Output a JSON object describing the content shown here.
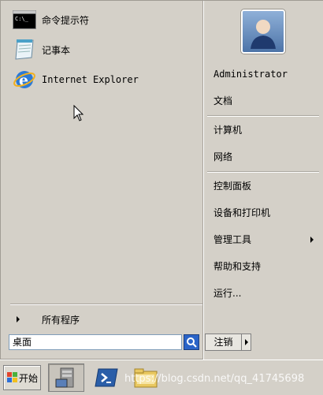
{
  "programs": [
    {
      "label": "命令提示符",
      "icon": "cmd-icon"
    },
    {
      "label": "记事本",
      "icon": "notepad-icon"
    },
    {
      "label": "Internet Explorer",
      "icon": "ie-icon"
    }
  ],
  "all_programs_label": "所有程序",
  "search": {
    "value": "桌面"
  },
  "user": {
    "name": "Administrator"
  },
  "right_items": {
    "documents": "文档",
    "computer": "计算机",
    "network": "网络",
    "control_panel": "控制面板",
    "devices_printers": "设备和打印机",
    "admin_tools": "管理工具",
    "help": "帮助和支持",
    "run": "运行..."
  },
  "logoff_label": "注销",
  "taskbar": {
    "start_label": "开始",
    "watermark": "https://blog.csdn.net/qq_41745698"
  }
}
